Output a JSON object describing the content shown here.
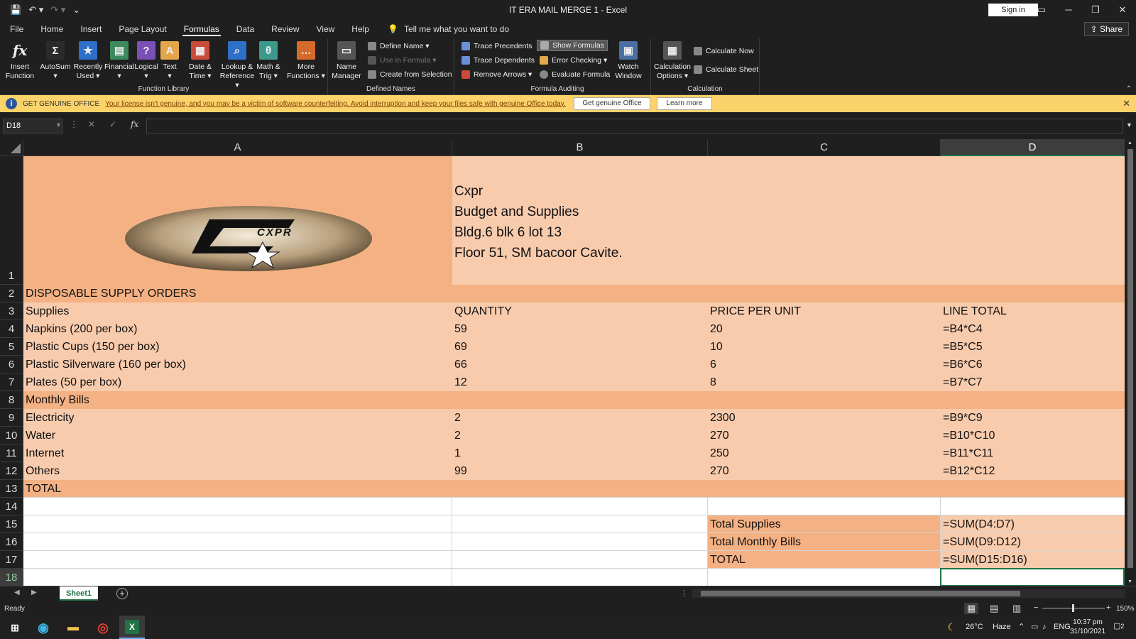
{
  "title": "IT ERA MAIL MERGE 1  -  Excel",
  "signin": "Sign in",
  "share": "Share",
  "menu": [
    "File",
    "Home",
    "Insert",
    "Page Layout",
    "Formulas",
    "Data",
    "Review",
    "View",
    "Help"
  ],
  "tellme": "Tell me what you want to do",
  "ribbon": {
    "insert_function": [
      "Insert",
      "Function"
    ],
    "lib": [
      {
        "l1": "AutoSum",
        "l2": "▾",
        "icon": "Σ",
        "color": "#2b2b2b"
      },
      {
        "l1": "Recently",
        "l2": "Used ▾",
        "icon": "★",
        "color": "#2e6fc9"
      },
      {
        "l1": "Financial",
        "l2": "▾",
        "icon": "▤",
        "color": "#3d8a5c"
      },
      {
        "l1": "Logical",
        "l2": "▾",
        "icon": "?",
        "color": "#7a4fb6"
      },
      {
        "l1": "Text",
        "l2": "▾",
        "icon": "A",
        "color": "#e3a64a"
      },
      {
        "l1": "Date &",
        "l2": "Time ▾",
        "icon": "▦",
        "color": "#c94c3a"
      },
      {
        "l1": "Lookup &",
        "l2": "Reference ▾",
        "icon": "⌕",
        "color": "#2e6fc9"
      },
      {
        "l1": "Math &",
        "l2": "Trig ▾",
        "icon": "θ",
        "color": "#3d9a8a"
      },
      {
        "l1": "More",
        "l2": "Functions ▾",
        "icon": "…",
        "color": "#d66a2a"
      }
    ],
    "function_library": "Function Library",
    "name_manager": [
      "Name",
      "Manager"
    ],
    "define_name": "Define Name  ▾",
    "use_in_formula": "Use in Formula ▾",
    "create_from_selection": "Create from Selection",
    "defined_names": "Defined Names",
    "trace_precedents": "Trace Precedents",
    "trace_dependents": "Trace Dependents",
    "remove_arrows": "Remove Arrows  ▾",
    "show_formulas": "Show Formulas",
    "error_checking": "Error Checking  ▾",
    "evaluate_formula": "Evaluate Formula",
    "watch_window": [
      "Watch",
      "Window"
    ],
    "formula_auditing": "Formula Auditing",
    "calc_options": [
      "Calculation",
      "Options ▾"
    ],
    "calc_now": "Calculate Now",
    "calc_sheet": "Calculate Sheet",
    "calculation": "Calculation"
  },
  "msgbar": {
    "label": "GET GENUINE OFFICE",
    "text": "Your license isn't genuine, and you may be a victim of software counterfeiting. Avoid interruption and keep your files safe with genuine Office today.",
    "btn1": "Get genuine Office",
    "btn2": "Learn more"
  },
  "namebox": "D18",
  "columns": [
    "A",
    "B",
    "C",
    "D"
  ],
  "rows": [
    "1",
    "2",
    "3",
    "4",
    "5",
    "6",
    "7",
    "8",
    "9",
    "10",
    "11",
    "12",
    "13",
    "14",
    "15",
    "16",
    "17",
    "18"
  ],
  "logo_text": "CXPR",
  "header_lines": [
    "Cxpr",
    "Budget and Supplies",
    "Bldg.6 blk 6 lot 13",
    "Floor 51, SM bacoor Cavite."
  ],
  "cells": {
    "a2": "DISPOSABLE SUPPLY ORDERS",
    "a3": "Supplies",
    "b3": "QUANTITY",
    "c3": "PRICE PER UNIT",
    "d3": "LINE TOTAL",
    "a4": "Napkins (200 per box)",
    "b4": "59",
    "c4": "20",
    "d4": "=B4*C4",
    "a5": "Plastic Cups (150 per box)",
    "b5": "69",
    "c5": "10",
    "d5": "=B5*C5",
    "a6": "Plastic Silverware (160 per box)",
    "b6": "66",
    "c6": "6",
    "d6": "=B6*C6",
    "a7": "Plates (50 per box)",
    "b7": "12",
    "c7": "8",
    "d7": "=B7*C7",
    "a8": "Monthly Bills",
    "a9": "Electricity",
    "b9": "2",
    "c9": "2300",
    "d9": "=B9*C9",
    "a10": "Water",
    "b10": "2",
    "c10": "270",
    "d10": "=B10*C10",
    "a11": "Internet",
    "b11": "1",
    "c11": "250",
    "d11": "=B11*C11",
    "a12": "Others",
    "b12": "99",
    "c12": "270",
    "d12": "=B12*C12",
    "a13": "TOTAL",
    "c15": "Total Supplies",
    "d15": "=SUM(D4:D7)",
    "c16": "Total Monthly Bills",
    "d16": "=SUM(D9:D12)",
    "c17": "TOTAL",
    "d17": "=SUM(D15:D16)"
  },
  "sheet_tab": "Sheet1",
  "status": "Ready",
  "zoom": "150%",
  "tray": {
    "temp": "26°C",
    "weather": "Haze",
    "lang": "ENG",
    "time": "10:37 pm",
    "date": "31/10/2021",
    "notif": "2"
  }
}
